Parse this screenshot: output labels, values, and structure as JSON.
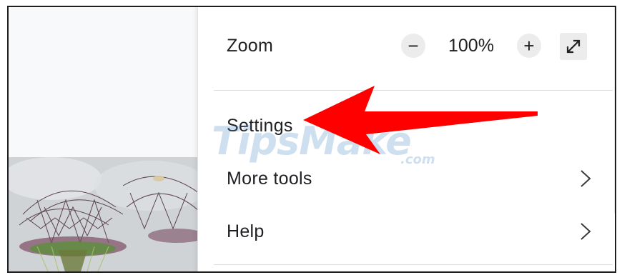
{
  "menu": {
    "zoom": {
      "label": "Zoom",
      "minus_symbol": "−",
      "value": "100%",
      "plus_symbol": "+",
      "fullscreen_icon": "fullscreen-icon"
    },
    "items": [
      {
        "label": "Settings",
        "has_submenu": false
      },
      {
        "label": "More tools",
        "has_submenu": true
      },
      {
        "label": "Help",
        "has_submenu": true
      }
    ]
  },
  "watermark": {
    "main": "TipsMake",
    "suffix": ".com"
  },
  "annotation": {
    "arrow_color": "#ff0000",
    "points_to": "Settings"
  },
  "colors": {
    "menu_background": "#ffffff",
    "text": "#202124",
    "divider": "#dcdcdc",
    "button_background": "#ececec"
  }
}
